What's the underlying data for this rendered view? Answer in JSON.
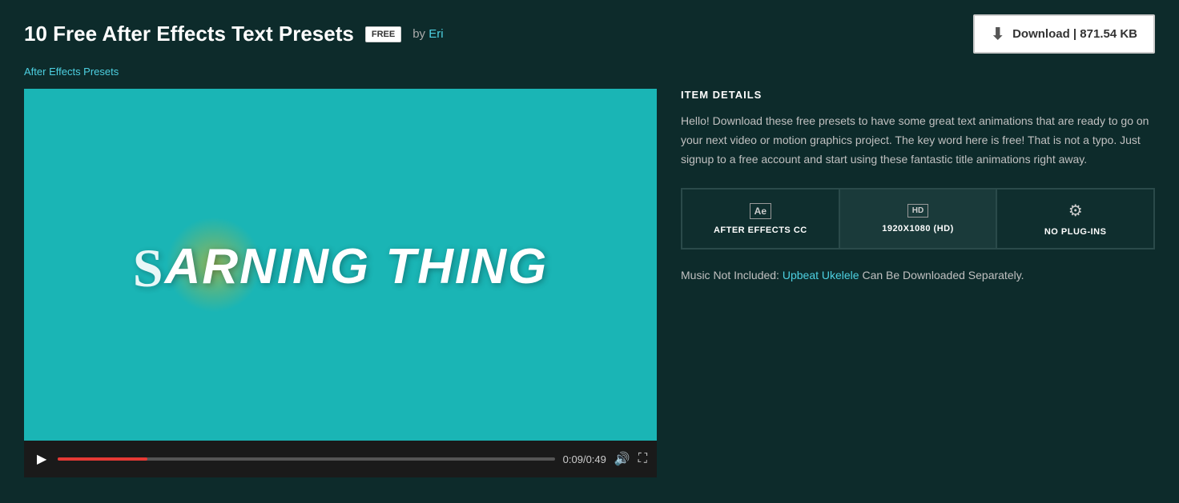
{
  "header": {
    "title": "10 Free After Effects Text Presets",
    "badge": "FREE",
    "by_text": "by",
    "author": "Eri",
    "download_label": "Download | 871.54 KB"
  },
  "breadcrumb": {
    "label": "After Effects Presets"
  },
  "video": {
    "display_text": "ARNING THING",
    "time_current": "0:09",
    "time_total": "0:49",
    "progress_percent": 18
  },
  "details": {
    "section_label": "ITEM DETAILS",
    "description": "Hello! Download these free presets to have some great text animations that are ready to go on your next video or motion graphics project. The key word here is free! That is not a typo. Just signup to a free account and start using these fantastic title animations right away.",
    "specs": [
      {
        "icon": "ae",
        "label": "AFTER EFFECTS CC"
      },
      {
        "icon": "hd",
        "label": "1920X1080 (HD)"
      },
      {
        "icon": "gear",
        "label": "NO PLUG-INS"
      }
    ],
    "music_text": "Music Not Included:",
    "music_link": "Upbeat Ukelele",
    "music_suffix": " Can Be Downloaded Separately."
  }
}
